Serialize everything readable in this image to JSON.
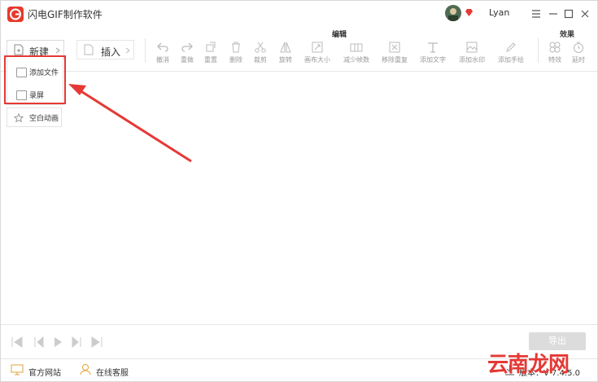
{
  "app": {
    "title": "闪电GIF制作软件",
    "username": "Lyan"
  },
  "toolbar": {
    "new_label": "新建",
    "insert_label": "插入",
    "edit_section": "编辑",
    "effects_section": "效果",
    "edit_tools": [
      {
        "label": "撤消",
        "icon": "undo-icon"
      },
      {
        "label": "重做",
        "icon": "redo-icon"
      },
      {
        "label": "重置",
        "icon": "reset-icon"
      },
      {
        "label": "删除",
        "icon": "delete-icon"
      },
      {
        "label": "裁剪",
        "icon": "cut-icon"
      },
      {
        "label": "旋转",
        "icon": "rotate-icon"
      },
      {
        "label": "画布大小",
        "icon": "canvas-size-icon"
      },
      {
        "label": "减少帧数",
        "icon": "reduce-frames-icon"
      },
      {
        "label": "移除重复",
        "icon": "remove-duplicates-icon"
      },
      {
        "label": "添加文字",
        "icon": "add-text-icon"
      },
      {
        "label": "添加水印",
        "icon": "add-watermark-icon"
      },
      {
        "label": "添加手绘",
        "icon": "add-drawing-icon"
      }
    ],
    "effect_tools": [
      {
        "label": "特效",
        "icon": "effects-icon"
      },
      {
        "label": "延时",
        "icon": "delay-icon"
      }
    ]
  },
  "new_menu": {
    "items": [
      "添加文件",
      "录屏"
    ],
    "blank_animation": "空白动画"
  },
  "playback": {
    "export_label": "导出"
  },
  "footer": {
    "website": "官方网站",
    "support": "在线客服",
    "version": "版本：V 7.4.5.0"
  },
  "watermark": "云南龙网",
  "colors": {
    "brand": "#e63a2e",
    "highlight": "#e53935",
    "disabled": "#dcdcdc"
  }
}
